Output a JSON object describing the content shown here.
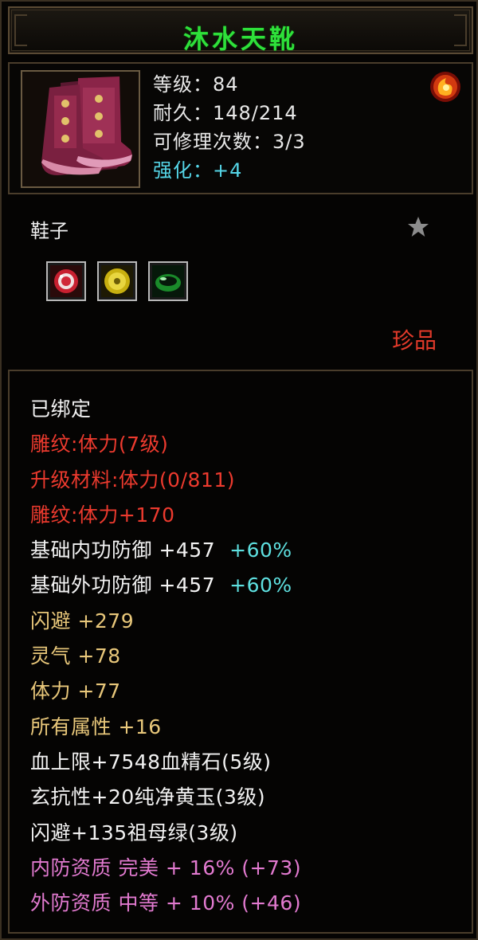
{
  "item": {
    "name": "沐水天靴",
    "level": "等级：84",
    "durability": "耐久：148/214",
    "repairs": "可修理次数：3/3",
    "enhance": "强化：+4",
    "type": "鞋子",
    "rarity": "珍品"
  },
  "gems": [
    {
      "name": "blood-gem"
    },
    {
      "name": "yellow-jade"
    },
    {
      "name": "emerald"
    }
  ],
  "attributes": {
    "bound": "已绑定",
    "engrave_level": "雕纹:体力(7级)",
    "upgrade_material": "升级材料:体力(0/811)",
    "engrave_bonus": "雕纹:体力+170",
    "inner_def_label": "基础内功防御  +457",
    "inner_def_pct": "+60%",
    "outer_def_label": "基础外功防御  +457",
    "outer_def_pct": "+60%",
    "dodge": "闪避  +279",
    "spirit": "灵气  +78",
    "stamina": "体力  +77",
    "all_attr": "所有属性  +16",
    "gem1": "血上限+7548血精石(5级)",
    "gem2": "玄抗性+20纯净黄玉(3级)",
    "gem3": "闪避+135祖母绿(3级)",
    "inner_quality": "内防资质  完美  +  16%  (+73)",
    "outer_quality": "外防资质  中等  +  10%  (+46)"
  },
  "colors": {
    "title": "#2ee03a",
    "red": "#ec3a2e",
    "gold": "#e8c77a",
    "pink": "#e27ad0",
    "cyan": "#5ee0e0"
  }
}
